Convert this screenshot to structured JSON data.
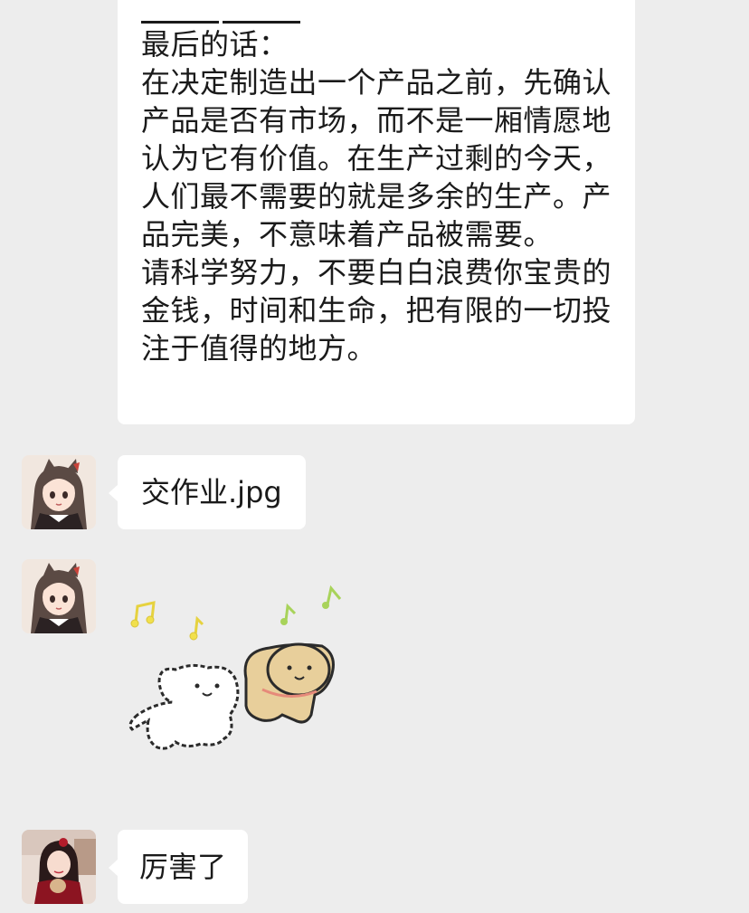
{
  "messages": {
    "long_text": {
      "title": "最后的话：",
      "paragraph1": "在决定制造出一个产品之前，先确认产品是否有市场，而不是一厢情愿地认为它有价值。在生产过剩的今天，人们最不需要的就是多余的生产。产品完美，不意味着产品被需要。",
      "paragraph2": "请科学努力，不要白白浪费你宝贵的金钱，时间和生命，把有限的一切投注于值得的地方。"
    },
    "file_message": "交作业.jpg",
    "reply_message": "厉害了"
  },
  "colors": {
    "background": "#ededed",
    "bubble": "#ffffff",
    "text": "#1a1a1a"
  },
  "icons": {
    "sticker": "dancing-dogs-sticker",
    "avatar1": "anime-girl-avatar",
    "avatar2": "girl-in-red-avatar"
  }
}
